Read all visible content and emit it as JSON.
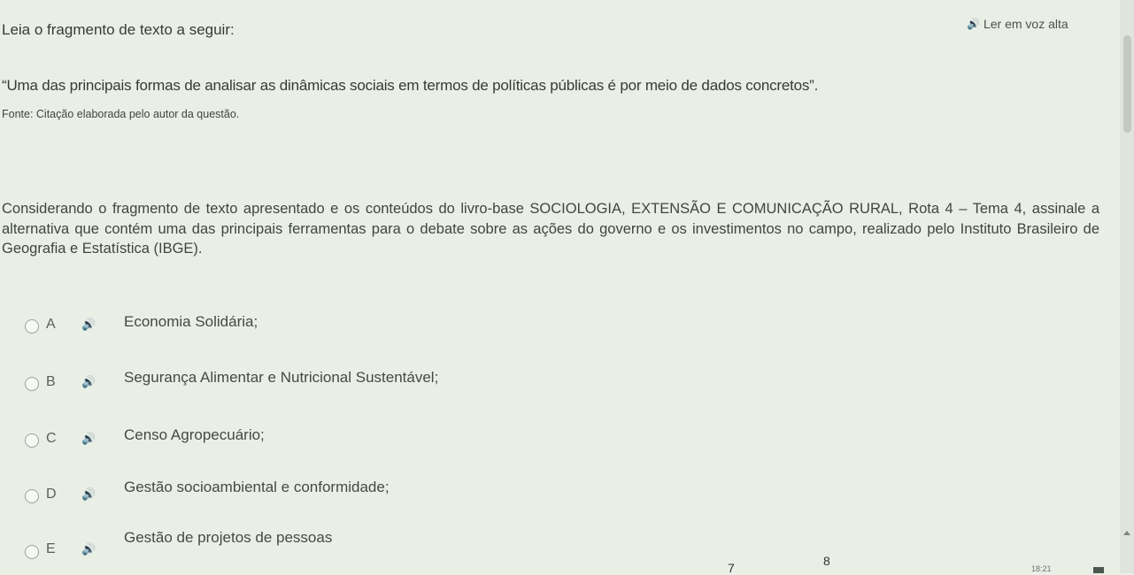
{
  "intro": "Leia o fragmento de texto a seguir:",
  "read_aloud": "Ler em voz alta",
  "quote": "“Uma das principais formas de analisar as dinâmicas sociais em termos de políticas públicas é por meio de dados concretos”.",
  "source": "Fonte: Citação elaborada pelo autor da questão.",
  "question": "Considerando o fragmento de texto apresentado e os conteúdos do livro-base SOCIOLOGIA, EXTENSÃO E COMUNICAÇÃO RURAL, Rota 4 – Tema 4, assinale a alternativa que contém uma das principais ferramentas para o debate sobre as ações do governo e os investimentos no campo, realizado pelo Instituto Brasileiro de Geografia e Estatística (IBGE).",
  "options": [
    {
      "letter": "A",
      "text": "Economia Solidária;"
    },
    {
      "letter": "B",
      "text": "Segurança Alimentar e Nutricional Sustentável;"
    },
    {
      "letter": "C",
      "text": "Censo Agropecuário;"
    },
    {
      "letter": "D",
      "text": "Gestão socioambiental e conformidade;"
    },
    {
      "letter": "E",
      "text": "Gestão de projetos de pessoas"
    }
  ],
  "pager": {
    "prev": "7",
    "current": "8"
  },
  "clock": "18:21",
  "icons": {
    "speaker": "speaker-icon",
    "radio": "radio-icon"
  },
  "colors": {
    "accent": "#3f7cc6",
    "background": "#eaefe6"
  }
}
